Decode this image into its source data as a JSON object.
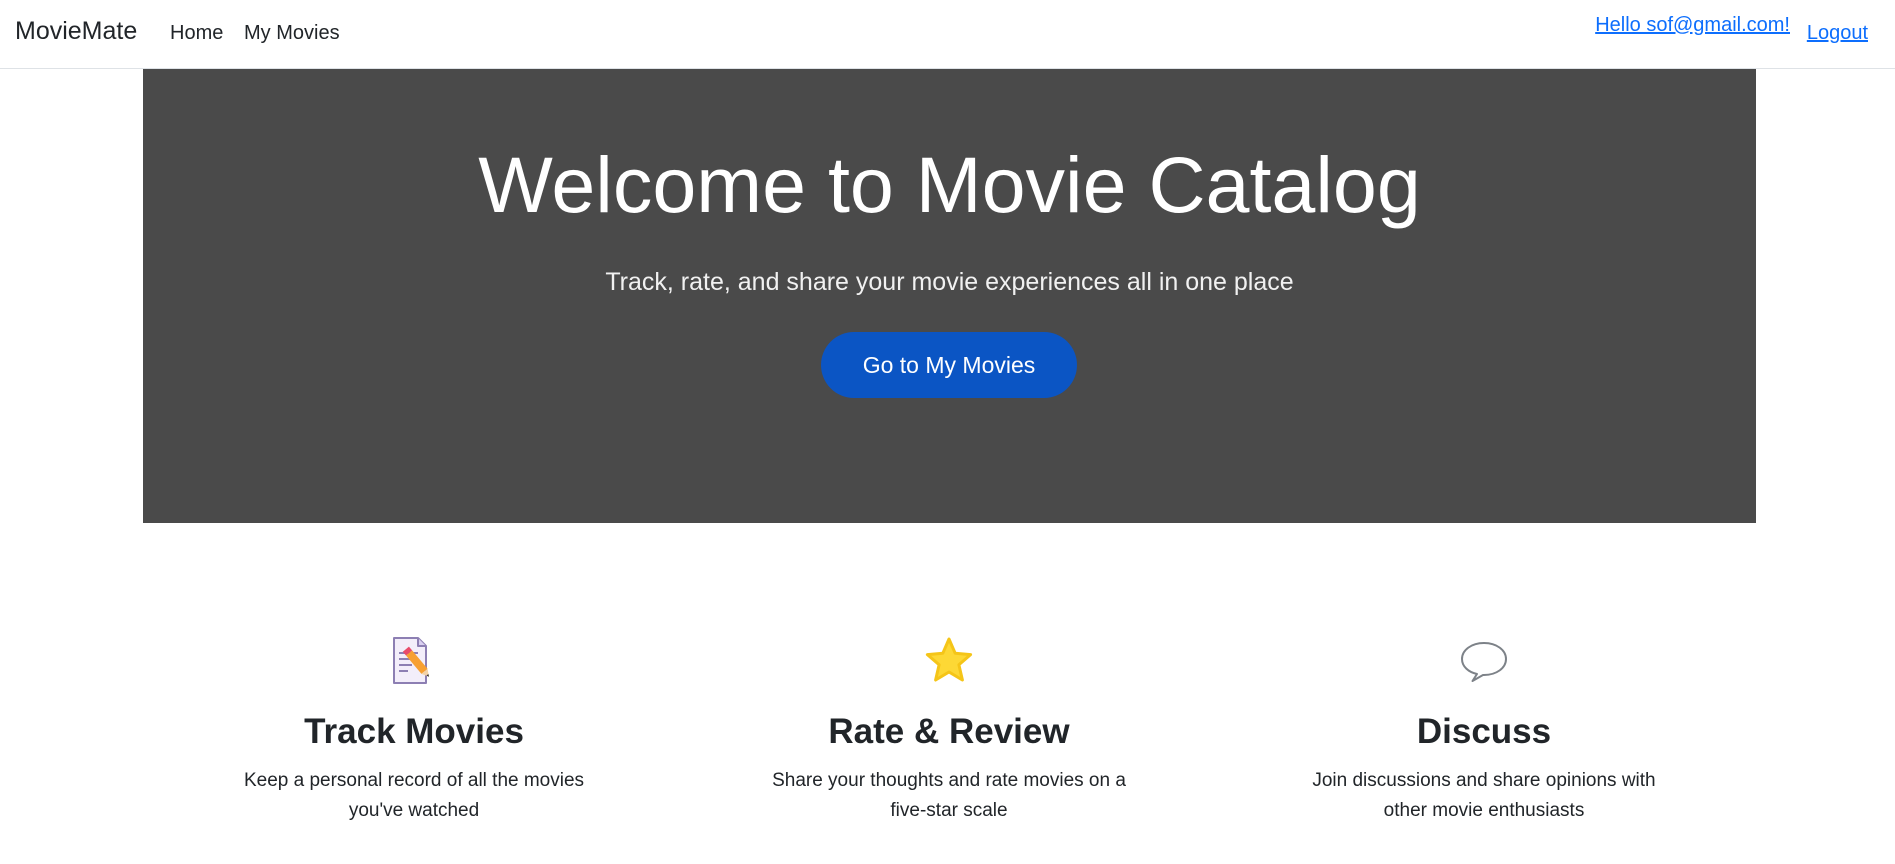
{
  "navbar": {
    "brand": "MovieMate",
    "links": [
      {
        "label": "Home"
      },
      {
        "label": "My Movies"
      }
    ],
    "user_greeting": "Hello sof@gmail.com!",
    "logout_label": "Logout",
    "link_color": "#0d6efd"
  },
  "hero": {
    "title": "Welcome to Movie Catalog",
    "subtitle": "Track, rate, and share your movie experiences all in one place",
    "button_label": "Go to My Movies",
    "background_color": "#4a4a4a",
    "button_color": "#0b55c4"
  },
  "features": [
    {
      "icon": "memo-pencil-icon",
      "title": "Track Movies",
      "text": "Keep a personal record of all the movies you've watched"
    },
    {
      "icon": "star-icon",
      "title": "Rate & Review",
      "text": "Share your thoughts and rate movies on a five-star scale"
    },
    {
      "icon": "speech-bubble-icon",
      "title": "Discuss",
      "text": "Join discussions and share opinions with other movie enthusiasts"
    }
  ]
}
